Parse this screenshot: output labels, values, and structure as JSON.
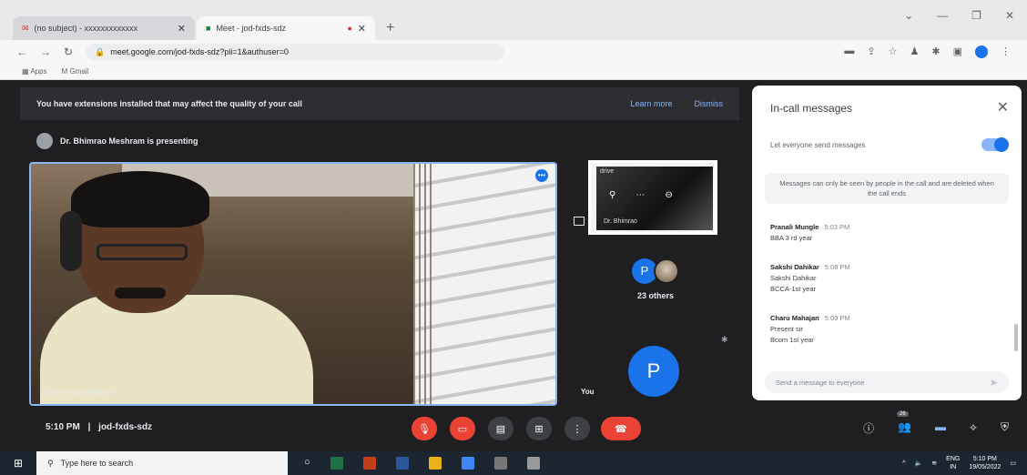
{
  "browser": {
    "tabs": [
      {
        "label": "(no subject) - xxxxxxxxxxxxx"
      },
      {
        "label": "Meet - jod-fxds-sdz"
      }
    ],
    "new_tab": "+",
    "url": "meet.google.com/jod-fxds-sdz?pli=1&authuser=0",
    "bookmarks": [
      "Apps",
      "Gmail"
    ]
  },
  "meet": {
    "banner_text": "You have extensions installed that may affect the quality of your call",
    "banner_learn_more": "Learn more",
    "banner_dismiss": "Dismiss",
    "presenting_text": "Dr. Bhimrao Meshram is presenting",
    "main_tile_name": "Dr. Bhimrao Meshram",
    "thumb_label": "drive",
    "thumb_name": "Dr. Bhimrao",
    "others_count": "23 others",
    "avatar_letter": "P",
    "you_label": "You",
    "meeting_time": "5:10 PM",
    "meeting_code": "jod-fxds-sdz",
    "separator": "|"
  },
  "chat": {
    "title": "In-call messages",
    "toggle_label": "Let everyone send messages",
    "notice": "Messages can only be seen by people in the call and are deleted when the call ends",
    "messages": [
      {
        "sender": "Pranali Mungle",
        "time": "5:03 PM",
        "text": "BBA 3 rd year"
      },
      {
        "sender": "Sakshi Dahikar",
        "time": "5:08 PM",
        "text": "Sakshi Dahikar",
        "text2": "BCCA-1st year"
      },
      {
        "sender": "Charu Mahajan",
        "time": "5:09 PM",
        "text": "Present sir",
        "text2": "Bcom 1st year"
      }
    ],
    "input_placeholder": "Send a message to everyone"
  },
  "controls": {
    "participants_badge": "26"
  },
  "taskbar": {
    "search_placeholder": "Type here to search",
    "lang": "ENG",
    "region": "IN",
    "time": "5:10 PM",
    "date": "19/05/2022"
  }
}
